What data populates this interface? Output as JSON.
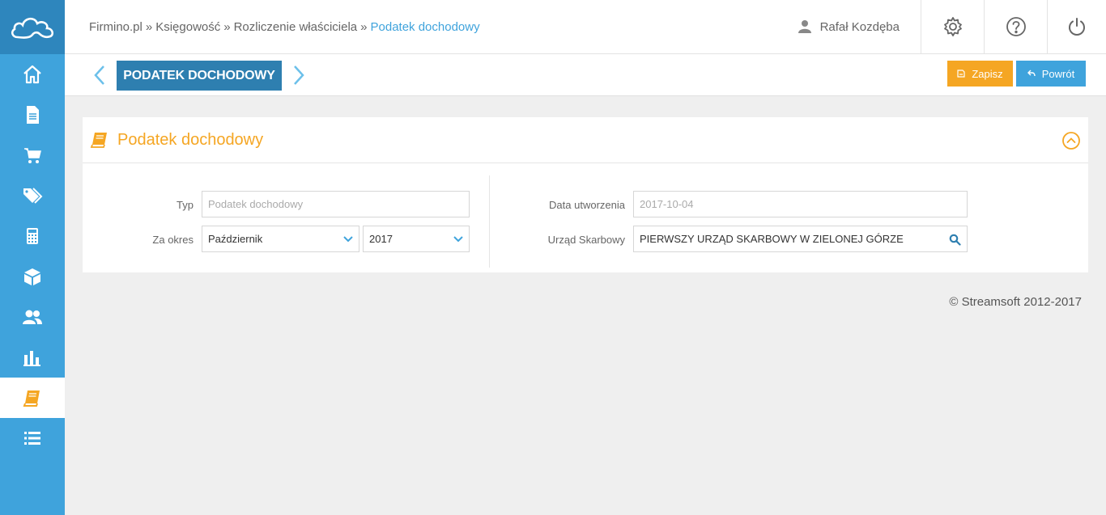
{
  "sidebar": {
    "logo_icon": "cloud-icon",
    "items": [
      {
        "name": "home",
        "icon": "home-icon"
      },
      {
        "name": "documents",
        "icon": "document-icon"
      },
      {
        "name": "purchases",
        "icon": "cart-icon"
      },
      {
        "name": "sales",
        "icon": "tags-icon"
      },
      {
        "name": "calculator",
        "icon": "calculator-icon"
      },
      {
        "name": "warehouse",
        "icon": "box-icon"
      },
      {
        "name": "contractors",
        "icon": "users-icon"
      },
      {
        "name": "reports",
        "icon": "bar-chart-icon"
      },
      {
        "name": "accounting",
        "icon": "book-icon",
        "active": true
      },
      {
        "name": "list",
        "icon": "list-icon"
      }
    ]
  },
  "header": {
    "breadcrumb": [
      "Firmino.pl",
      "Księgowość",
      "Rozliczenie właściciela",
      "Podatek dochodowy"
    ],
    "separator": "»",
    "user_name": "Rafał Kozdęba"
  },
  "subheader": {
    "page_tag": "PODATEK DOCHODOWY",
    "save_label": "Zapisz",
    "back_label": "Powrót"
  },
  "panel": {
    "title": "Podatek dochodowy",
    "fields": {
      "typ_label": "Typ",
      "typ_placeholder": "Podatek dochodowy",
      "okres_label": "Za okres",
      "okres_month": "Październik",
      "okres_year": "2017",
      "data_label": "Data utworzenia",
      "data_value": "2017-10-04",
      "urzad_label": "Urząd Skarbowy",
      "urzad_value": "PIERWSZY URZĄD SKARBOWY W ZIELONEJ GÓRZE"
    }
  },
  "footer": {
    "copyright": "© Streamsoft 2012-2017"
  },
  "colors": {
    "sidebar": "#3fa3dc",
    "sidebar_dark": "#2e86bd",
    "accent_orange": "#f5a623",
    "accent_blue": "#3fa3dc",
    "tag_blue": "#2e7fb0"
  }
}
